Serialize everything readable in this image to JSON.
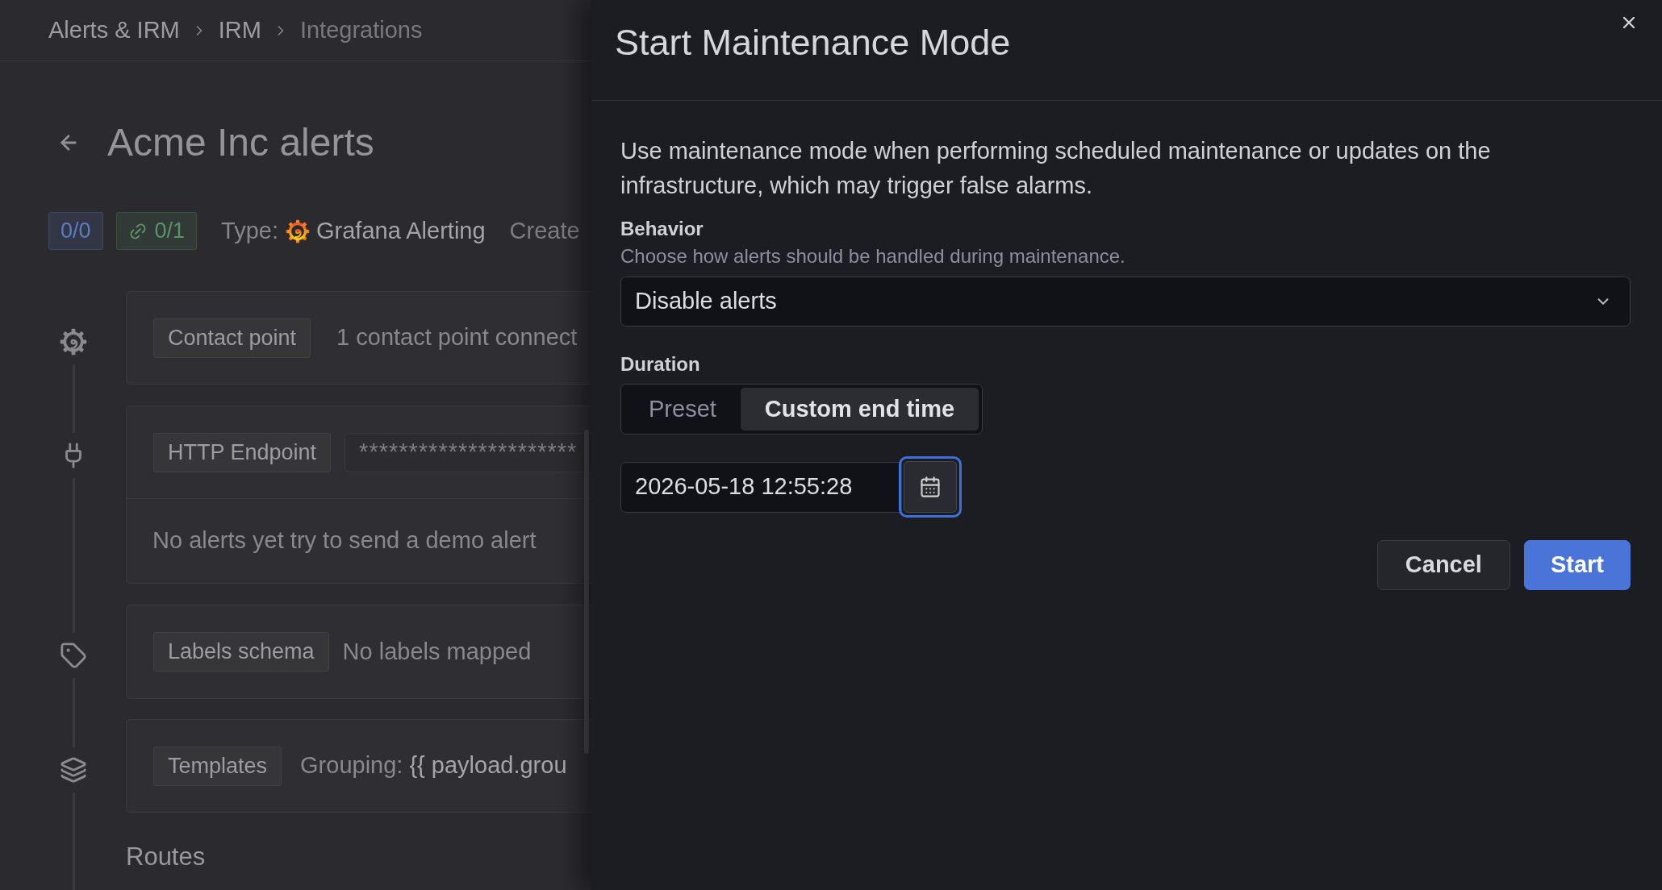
{
  "breadcrumbs": [
    {
      "label": "Alerts & IRM",
      "current": false
    },
    {
      "label": "IRM",
      "current": false
    },
    {
      "label": "Integrations",
      "current": true
    }
  ],
  "page": {
    "title": "Acme Inc alerts",
    "badges": [
      {
        "kind": "count",
        "text": "0/0",
        "color": "#5b7cc2"
      },
      {
        "kind": "link",
        "text": "0/1",
        "color": "#5a9466"
      }
    ],
    "type_label": "Type:",
    "type_value": "Grafana Alerting",
    "info_text": "Create"
  },
  "sections": [
    {
      "kind": "contact_point",
      "tag": "Contact point",
      "text": "1 contact point connect"
    },
    {
      "kind": "endpoint",
      "tag": "HTTP Endpoint",
      "masked_value": "**********************",
      "note": "No alerts yet try to send a demo alert"
    },
    {
      "kind": "labels",
      "tag": "Labels schema",
      "text": "No labels mapped"
    },
    {
      "kind": "templates",
      "tag": "Templates",
      "text": "Grouping:",
      "code": "{{ payload.grou"
    }
  ],
  "routes_heading": "Routes",
  "drawer": {
    "title": "Start Maintenance Mode",
    "description": "Use maintenance mode when performing scheduled maintenance or updates on the infrastructure, which may trigger false alarms.",
    "behavior": {
      "label": "Behavior",
      "hint": "Choose how alerts should be handled during maintenance.",
      "value": "Disable alerts"
    },
    "duration": {
      "label": "Duration",
      "options": [
        {
          "label": "Preset",
          "selected": false
        },
        {
          "label": "Custom end time",
          "selected": true
        }
      ],
      "end_time": "2026-05-18 12:55:28",
      "picker_focused": true
    },
    "buttons": [
      {
        "kind": "secondary",
        "label": "Cancel"
      },
      {
        "kind": "primary",
        "label": "Start"
      }
    ]
  }
}
